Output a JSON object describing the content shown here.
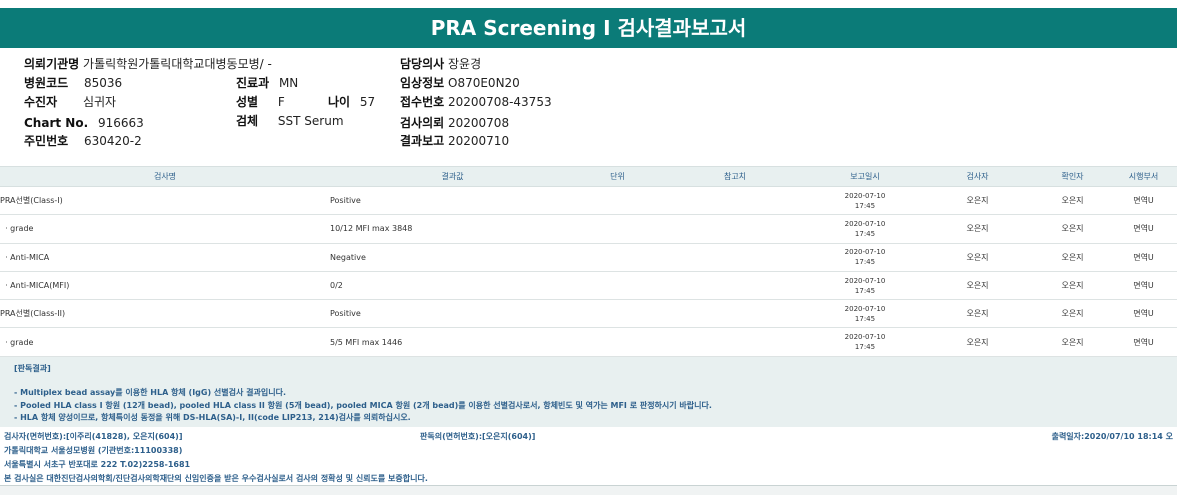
{
  "title": "PRA Screening I 검사결과보고서",
  "patient": {
    "institution_label": "의뢰기관명",
    "institution": "가톨릭학원가톨릭대학교대병동모병/ -",
    "hospital_code_label": "병원코드",
    "hospital_code": "85036",
    "department_label": "진료과",
    "department": "MN",
    "recipient_label": "수진자",
    "recipient": "심귀자",
    "sex_label": "성별",
    "sex": "F",
    "age_label": "나이",
    "age": "57",
    "chart_label": "Chart No.",
    "chart": "916663",
    "specimen_label": "검체",
    "specimen": "SST Serum",
    "resident_label": "주민번호",
    "resident": "630420-2",
    "doctor_label": "담당의사",
    "doctor": "장윤경",
    "clinical_label": "임상정보",
    "clinical": "O870E0N20",
    "receipt_label": "접수번호",
    "receipt": "20200708-43753",
    "request_label": "검사의뢰",
    "request": "20200708",
    "report_label": "결과보고",
    "report": "20200710"
  },
  "table": {
    "headers": [
      "검사명",
      "결과값",
      "단위",
      "참고치",
      "보고일시",
      "검사자",
      "확인자",
      "시행부서"
    ],
    "rows": [
      {
        "name": "PRA선별(Class-I)",
        "result": "Positive",
        "unit": "",
        "ref": "",
        "date": "2020-07-10",
        "time": "17:45",
        "tester": "오은지",
        "checker": "오은지",
        "dept": "면역U"
      },
      {
        "name": "  · grade",
        "result": "10/12 MFI max 3848",
        "unit": "",
        "ref": "",
        "date": "2020-07-10",
        "time": "17:45",
        "tester": "오은지",
        "checker": "오은지",
        "dept": "면역U"
      },
      {
        "name": "  · Anti-MICA",
        "result": "Negative",
        "unit": "",
        "ref": "",
        "date": "2020-07-10",
        "time": "17:45",
        "tester": "오은지",
        "checker": "오은지",
        "dept": "면역U"
      },
      {
        "name": "  · Anti-MICA(MFI)",
        "result": "0/2",
        "unit": "",
        "ref": "",
        "date": "2020-07-10",
        "time": "17:45",
        "tester": "오은지",
        "checker": "오은지",
        "dept": "면역U"
      },
      {
        "name": "PRA선별(Class-II)",
        "result": "Positive",
        "unit": "",
        "ref": "",
        "date": "2020-07-10",
        "time": "17:45",
        "tester": "오은지",
        "checker": "오은지",
        "dept": "면역U"
      },
      {
        "name": "  · grade",
        "result": "5/5 MFI max 1446",
        "unit": "",
        "ref": "",
        "date": "2020-07-10",
        "time": "17:45",
        "tester": "오은지",
        "checker": "오은지",
        "dept": "면역U"
      }
    ]
  },
  "notes": {
    "heading": "[판독결과]",
    "lines": [
      "- Multiplex bead assay를 이용한 HLA 항체 (IgG) 선별검사 결과입니다.",
      "- Pooled HLA class I 항원 (12개 bead), pooled HLA class II 항원 (5개 bead), pooled MICA 항원 (2개 bead)를 이용한 선별검사로서, 항체빈도 및 역가는 MFI 로 판정하시기 바랍니다.",
      "- HLA 항체 양성이므로, 항체특이성 동정을 위해 DS-HLA(SA)-I, II(code LIP213, 214)검사를 의뢰하십시오."
    ]
  },
  "footer": {
    "tester": "검사자(면허번호):[이주리(41828), 오은지(604)]",
    "reviewer": "판독의(면허번호):[오은지(604)]",
    "printed": "출력일자:2020/07/10 18:14 오",
    "lab_name": "가톨릭대학교 서울성모병원 (기관번호:11100338)",
    "address": "서울특별시 서초구 반포대로 222 T.02)2258-1681",
    "certification": "본 검사실은 대한진단검사의학회/진단검사의학재단의 신임인증을 받은 우수검사실로서 검사의 정확성 및 신뢰도를 보증합니다."
  }
}
